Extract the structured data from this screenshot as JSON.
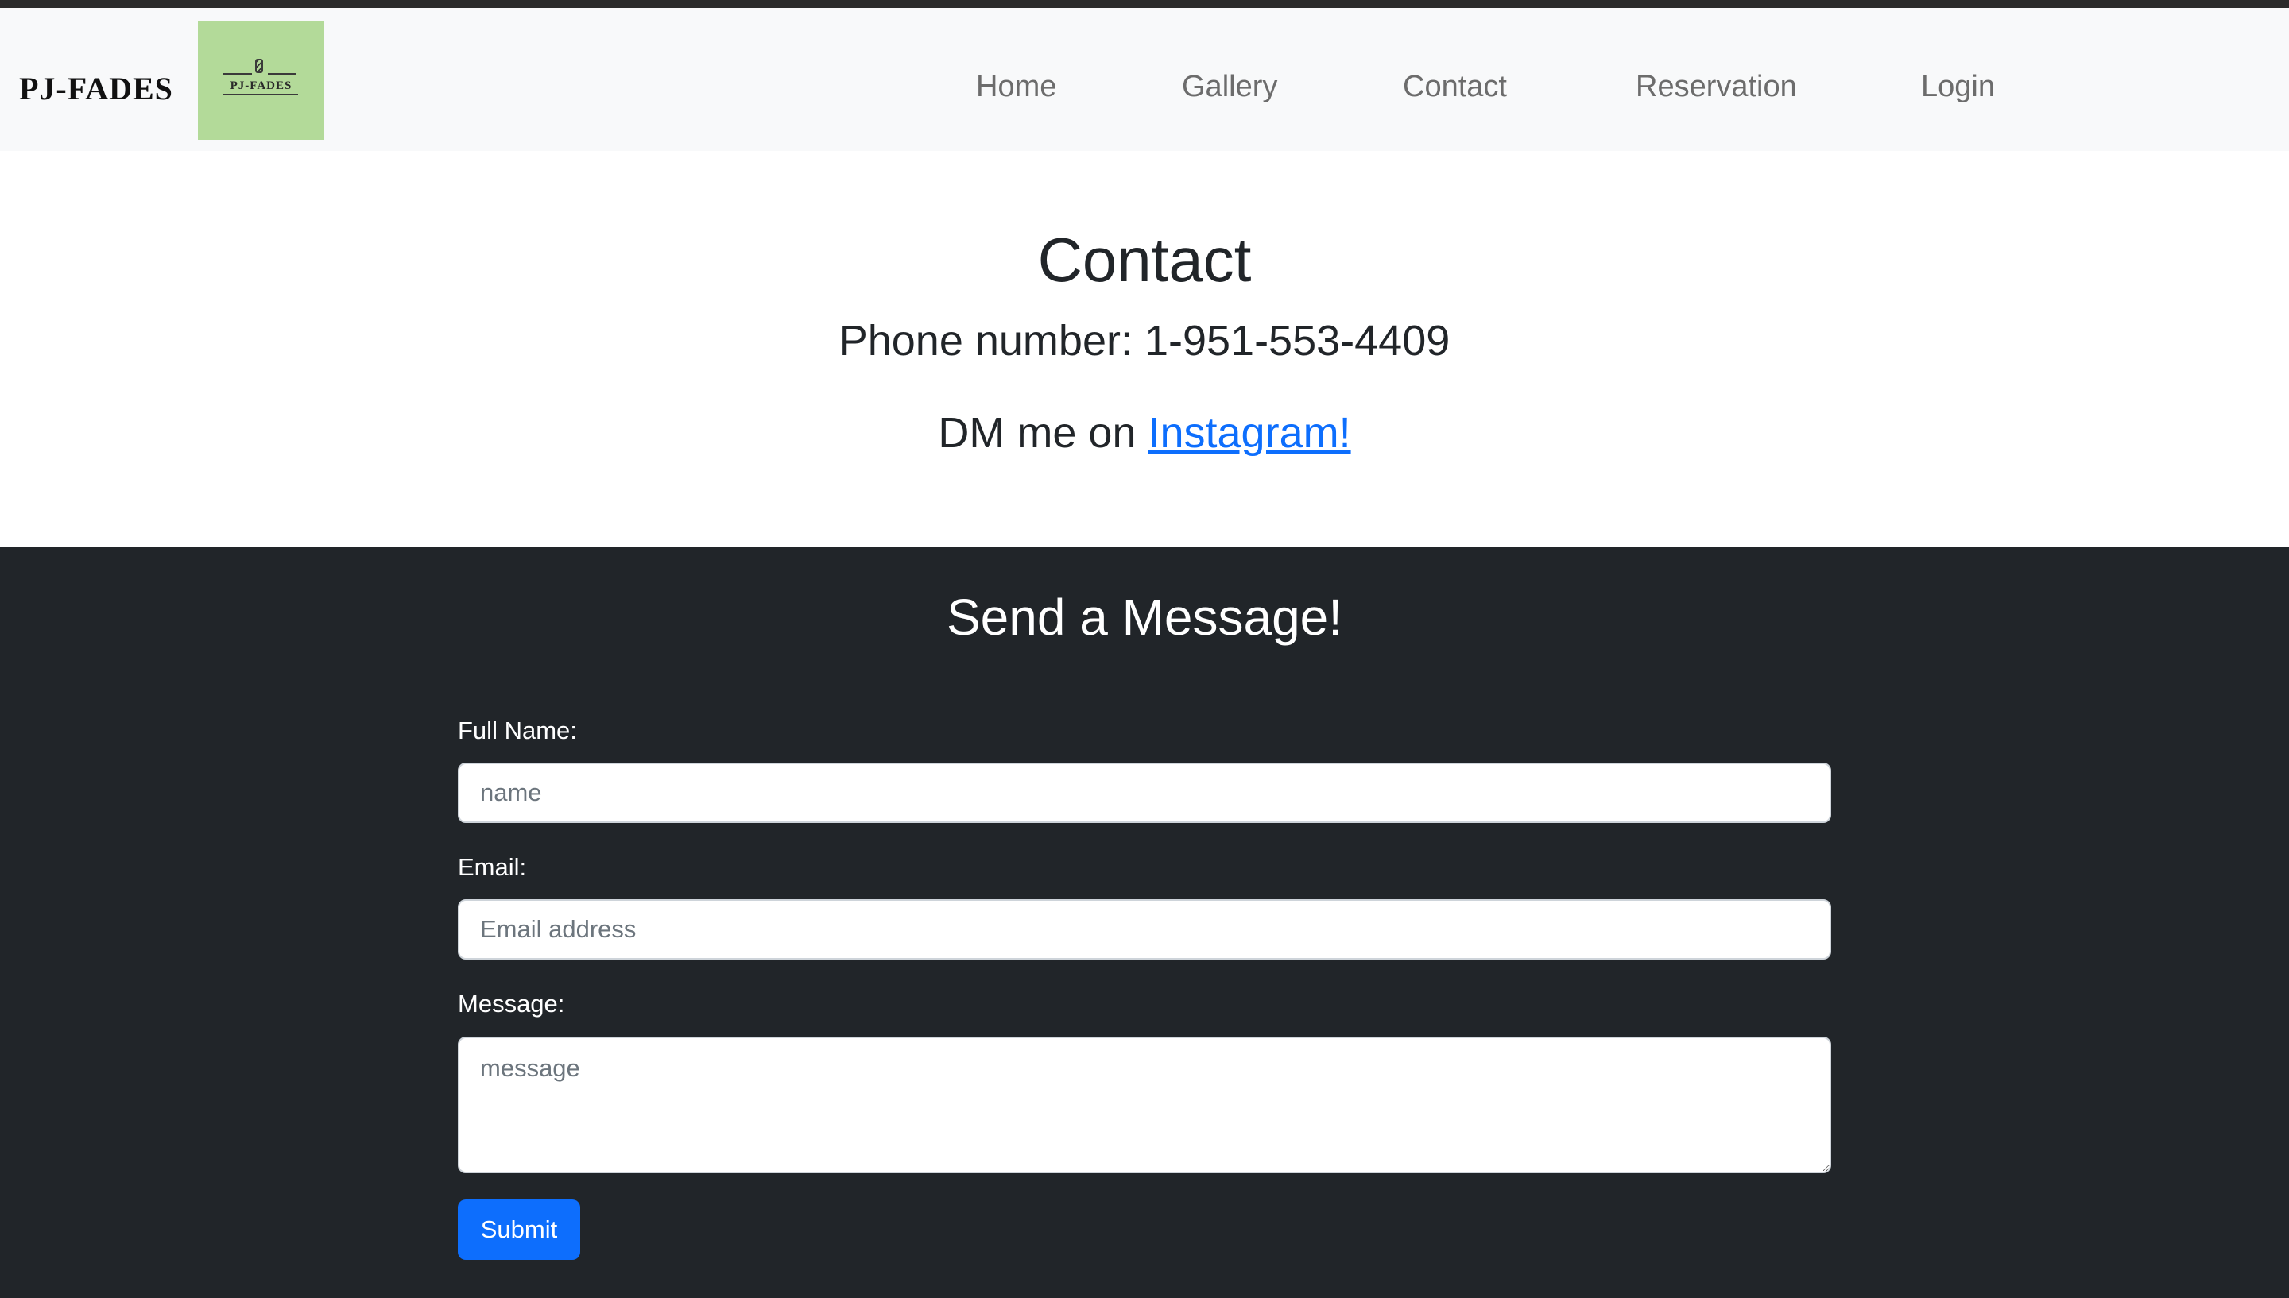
{
  "navbar": {
    "brand": "PJ-FADES",
    "logo_text": "PJ-FADES",
    "logo_icon": "barber-pole-icon",
    "links": [
      "Home",
      "Gallery",
      "Contact",
      "Reservation",
      "Login"
    ]
  },
  "contact": {
    "title": "Contact",
    "phone_text": "Phone number: 1-951-553-4409",
    "dm_prefix": "DM me on ",
    "instagram_link": "Instagram!"
  },
  "message_form": {
    "title": "Send a Message!",
    "full_name_label": "Full Name:",
    "full_name_placeholder": "name",
    "email_label": "Email:",
    "email_placeholder": "Email address",
    "message_label": "Message:",
    "message_placeholder": "message",
    "submit_label": "Submit"
  },
  "colors": {
    "navbar_bg": "#f8f9fa",
    "logo_bg": "#b3da99",
    "link_blue": "#0d6efd",
    "dark_section_bg": "#212529",
    "submit_bg": "#0d6efd"
  }
}
